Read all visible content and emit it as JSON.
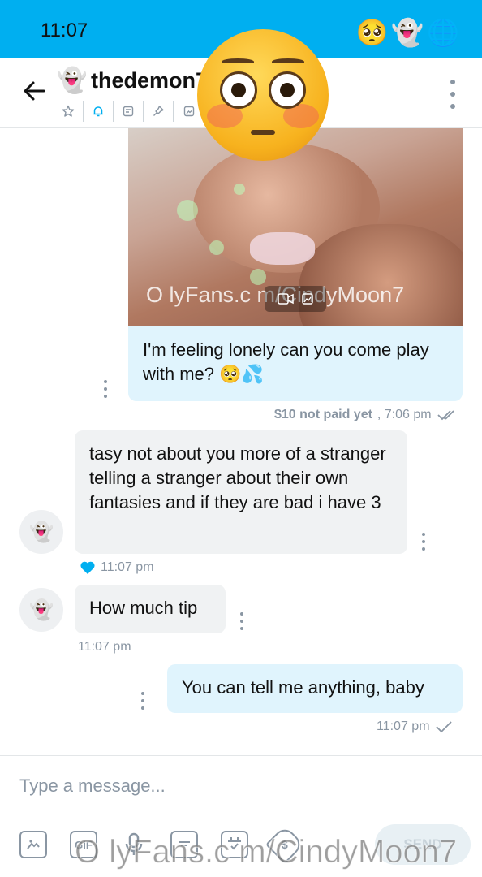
{
  "status_bar": {
    "time": "11:07",
    "icons": [
      "🥺",
      "👻",
      "🌐"
    ],
    "color": "#00aff0"
  },
  "header": {
    "avatar_emoji": "👻",
    "username": "thedemon7",
    "tools": [
      "star-icon",
      "bell-icon",
      "note-icon",
      "pin-icon",
      "image-icon"
    ]
  },
  "overlay_emoji": "😳",
  "messages": {
    "media_watermark": "O lyFans.c m/CindyMoon7",
    "msg1": {
      "text": "I'm feeling lonely can you come play with me? 🥺💦",
      "price": "$10 not paid yet",
      "time": ", 7:06 pm"
    },
    "msg2": {
      "text": "tasy not about you more of a stranger telling a stranger about their own fantasies and if they are bad i have 3",
      "avatar": "👻",
      "time": "11:07 pm"
    },
    "msg3": {
      "text": "How much tip",
      "avatar": "👻",
      "time": "11:07 pm"
    },
    "msg4": {
      "text": "You can tell me anything, baby",
      "time": "11:07 pm"
    }
  },
  "composer": {
    "placeholder": "Type a message...",
    "send_label": "SEND",
    "tools": [
      "image-icon",
      "gif-icon",
      "mic-icon",
      "vault-icon",
      "calendar-icon",
      "price-tag-icon"
    ],
    "watermark": "O lyFans.c m/CindyMoon7"
  },
  "colors": {
    "accent": "#00aff0",
    "bubble_out": "#e0f4fd",
    "bubble_in": "#f0f2f3",
    "muted": "#8a96a3"
  }
}
